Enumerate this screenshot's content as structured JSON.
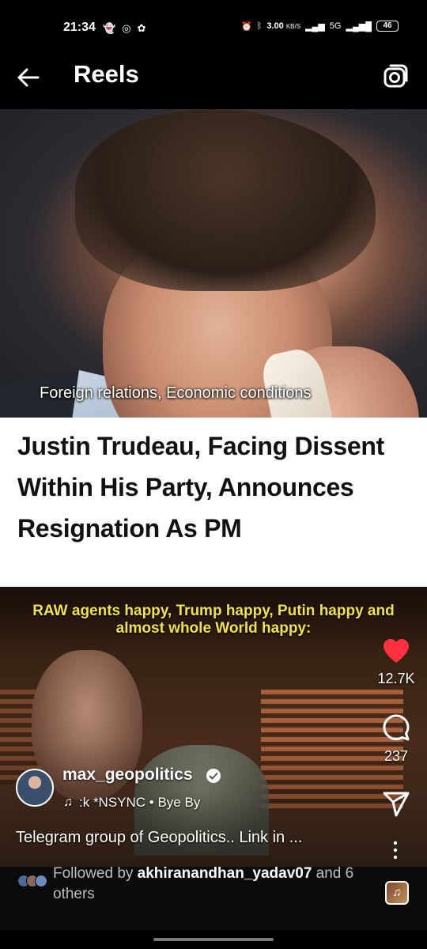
{
  "status_bar": {
    "time": "21:34",
    "speed_value": "3.00",
    "speed_unit": "KB/S",
    "network": "5G",
    "battery": "46"
  },
  "header": {
    "title": "Reels"
  },
  "reel_top": {
    "caption": "Foreign relations, Economic conditions"
  },
  "headline": {
    "text": "Justin Trudeau, Facing Dissent Within His Party, Announces Resignation As PM"
  },
  "reel_bottom": {
    "caption": "RAW agents happy, Trump happy, Putin happy and almost whole World happy:"
  },
  "actions": {
    "likes": "12.7K",
    "comments": "237"
  },
  "account": {
    "username": "max_geopolitics",
    "audio": ":k   *NSYNC • Bye By",
    "description": "Telegram group of Geopolitics.. Link in ..."
  },
  "followed": {
    "prefix": "Followed by ",
    "user": "akhiranandhan_yadav07",
    "suffix": " and 6 others"
  },
  "colors": {
    "like": "#ff3040",
    "caption_yellow": "#f2e34a"
  }
}
